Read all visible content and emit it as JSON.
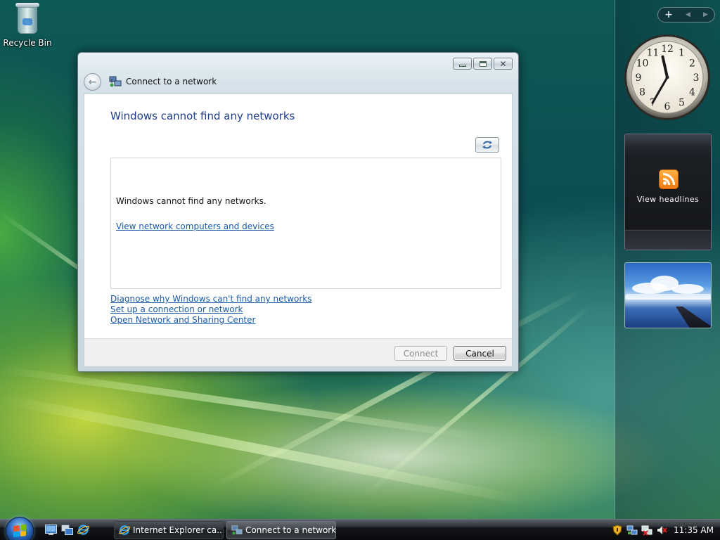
{
  "desktop": {
    "icons": [
      {
        "label": "Recycle Bin",
        "icon": "recycle-bin-icon"
      }
    ]
  },
  "sidebar": {
    "controls": {
      "add": "+",
      "prev": "◀",
      "next": "▶"
    },
    "clock": {
      "numerals": [
        "12",
        "1",
        "2",
        "3",
        "4",
        "5",
        "6",
        "7",
        "8",
        "9",
        "10",
        "11"
      ],
      "hour": 11,
      "minute": 35
    },
    "feed_headlines": {
      "label": "View headlines",
      "icon": "rss-icon"
    },
    "slide_show": {
      "icon": "slideshow-image"
    }
  },
  "window": {
    "title": "Connect to a network",
    "heading": "Windows cannot find any networks",
    "list_message": "Windows cannot find any networks.",
    "list_link": "View network computers and devices",
    "task_links": [
      "Diagnose why Windows can't find any networks",
      "Set up a connection or network",
      "Open Network and Sharing Center"
    ],
    "buttons": {
      "connect": "Connect",
      "cancel": "Cancel"
    },
    "caption_buttons": {
      "close": "✕"
    }
  },
  "taskbar": {
    "quick_launch": [
      "show-desktop-icon",
      "switch-windows-icon",
      "internet-explorer-icon"
    ],
    "tasks": [
      {
        "label": "Internet Explorer ca...",
        "icon": "internet-explorer-icon",
        "active": false
      },
      {
        "label": "Connect to a network",
        "icon": "network-icon",
        "active": true
      }
    ],
    "tray_icons": [
      "security-shield-icon",
      "network-status-icon",
      "network-disconnected-icon",
      "volume-muted-icon"
    ],
    "time": "11:35 AM"
  },
  "colors": {
    "heading": "#1e3d8c",
    "link": "#1a5aa6",
    "feed_orange": "#f07a12"
  }
}
